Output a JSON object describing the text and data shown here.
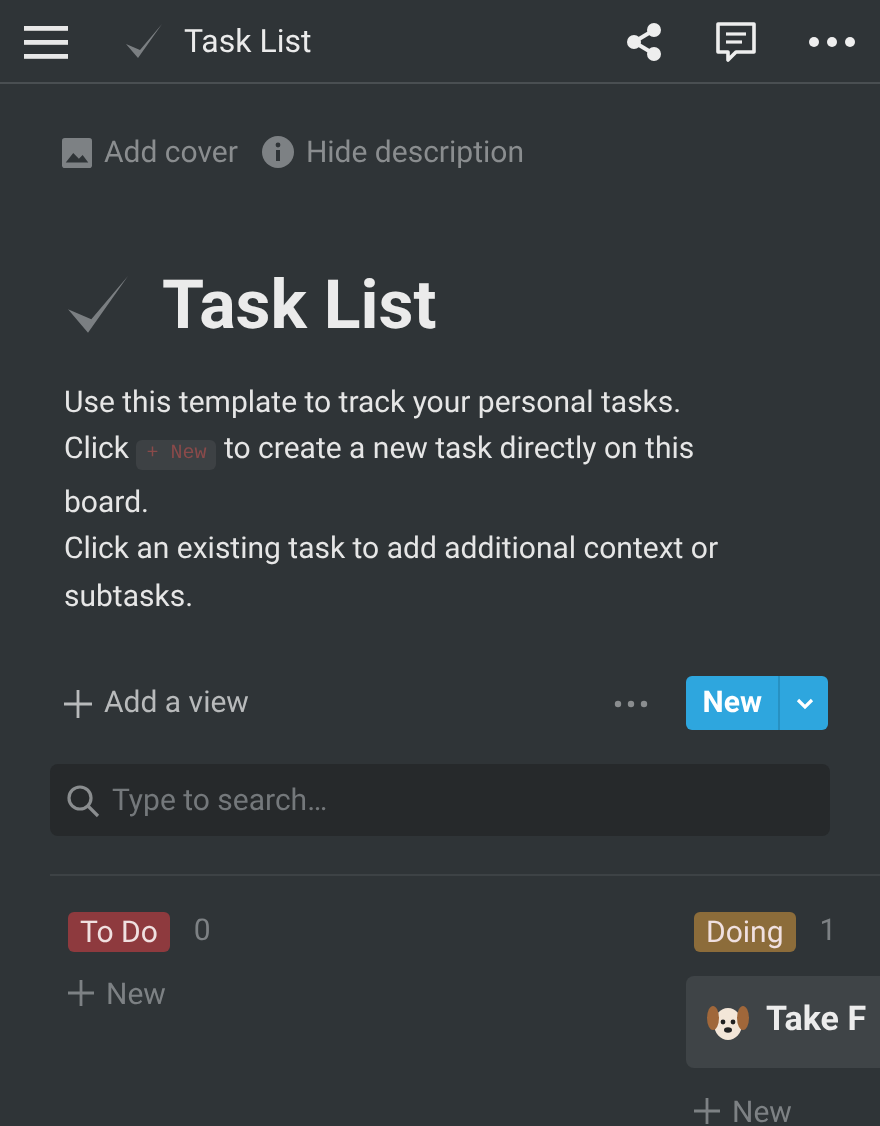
{
  "header": {
    "title": "Task List"
  },
  "page_actions": [
    "Add cover",
    "Hide description"
  ],
  "page": {
    "title": "Task List"
  },
  "description": [
    {
      "kind": "text",
      "text": "Use this template to track your personal tasks."
    },
    {
      "kind": "mixed",
      "before": "Click",
      "code": "+ New",
      "after": "to create a new task directly on this board."
    },
    {
      "kind": "text",
      "text": "Click an existing task to add additional context or subtasks."
    }
  ],
  "toolbar": {
    "add_view": "Add a view",
    "new_button": "New"
  },
  "search": {
    "placeholder": "Type to search…"
  },
  "board": [
    {
      "label": "To Do",
      "color": "#8e3a3e",
      "count": "0",
      "new_label": "New"
    },
    {
      "label": "Doing",
      "color": "#8c6c3a",
      "count": "1",
      "cards": [
        {
          "title": "Take F"
        }
      ],
      "new_label": "New"
    }
  ]
}
